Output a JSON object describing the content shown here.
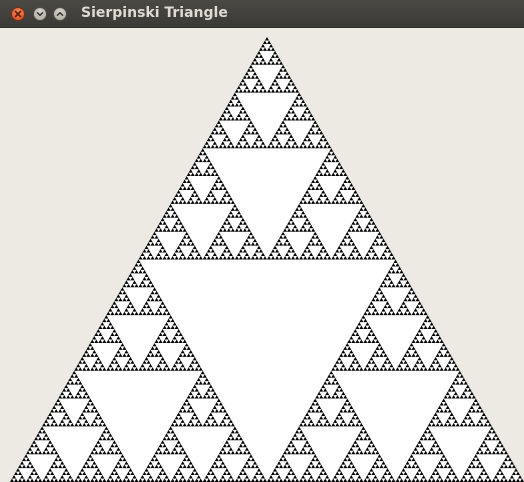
{
  "window": {
    "title": "Sierpinski Triangle",
    "background_color": "#edeae4",
    "titlebar_color": "#3c3b37"
  },
  "controls": {
    "close_icon": "close-icon",
    "minimize_icon": "chevron-down-icon",
    "maximize_icon": "chevron-up-icon"
  },
  "fractal": {
    "type": "sierpinski-triangle",
    "depth": 7,
    "fill_color": "#000000",
    "hole_color": "#ffffff"
  }
}
